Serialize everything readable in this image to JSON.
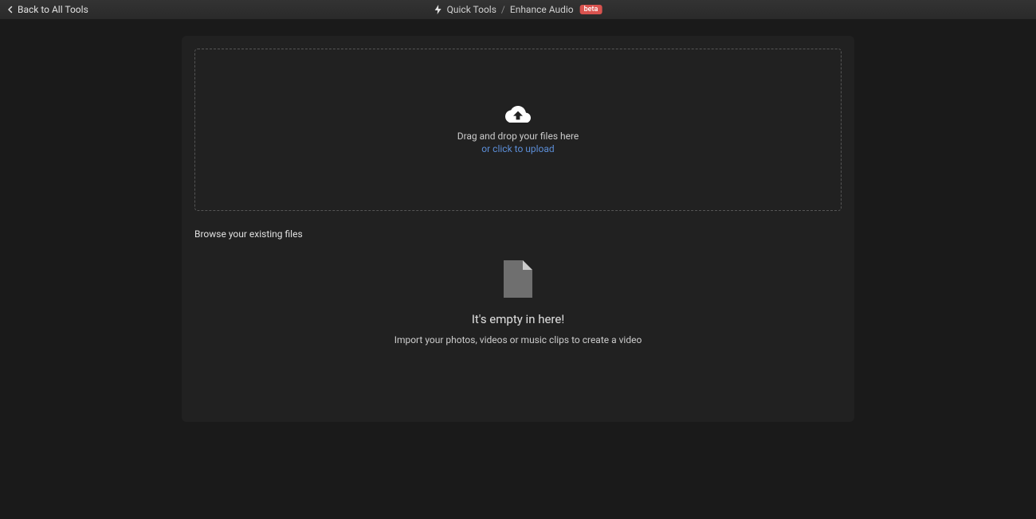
{
  "header": {
    "back_label": "Back to All Tools",
    "breadcrumb_quick_tools": "Quick Tools",
    "breadcrumb_separator": "/",
    "breadcrumb_enhance_audio": "Enhance Audio",
    "beta_label": "beta"
  },
  "dropzone": {
    "main_text": "Drag and drop your files here",
    "link_text": "or click to upload"
  },
  "browse": {
    "title": "Browse your existing files",
    "empty_title": "It's empty in here!",
    "empty_subtitle": "Import your photos, videos or music clips to create a video"
  }
}
